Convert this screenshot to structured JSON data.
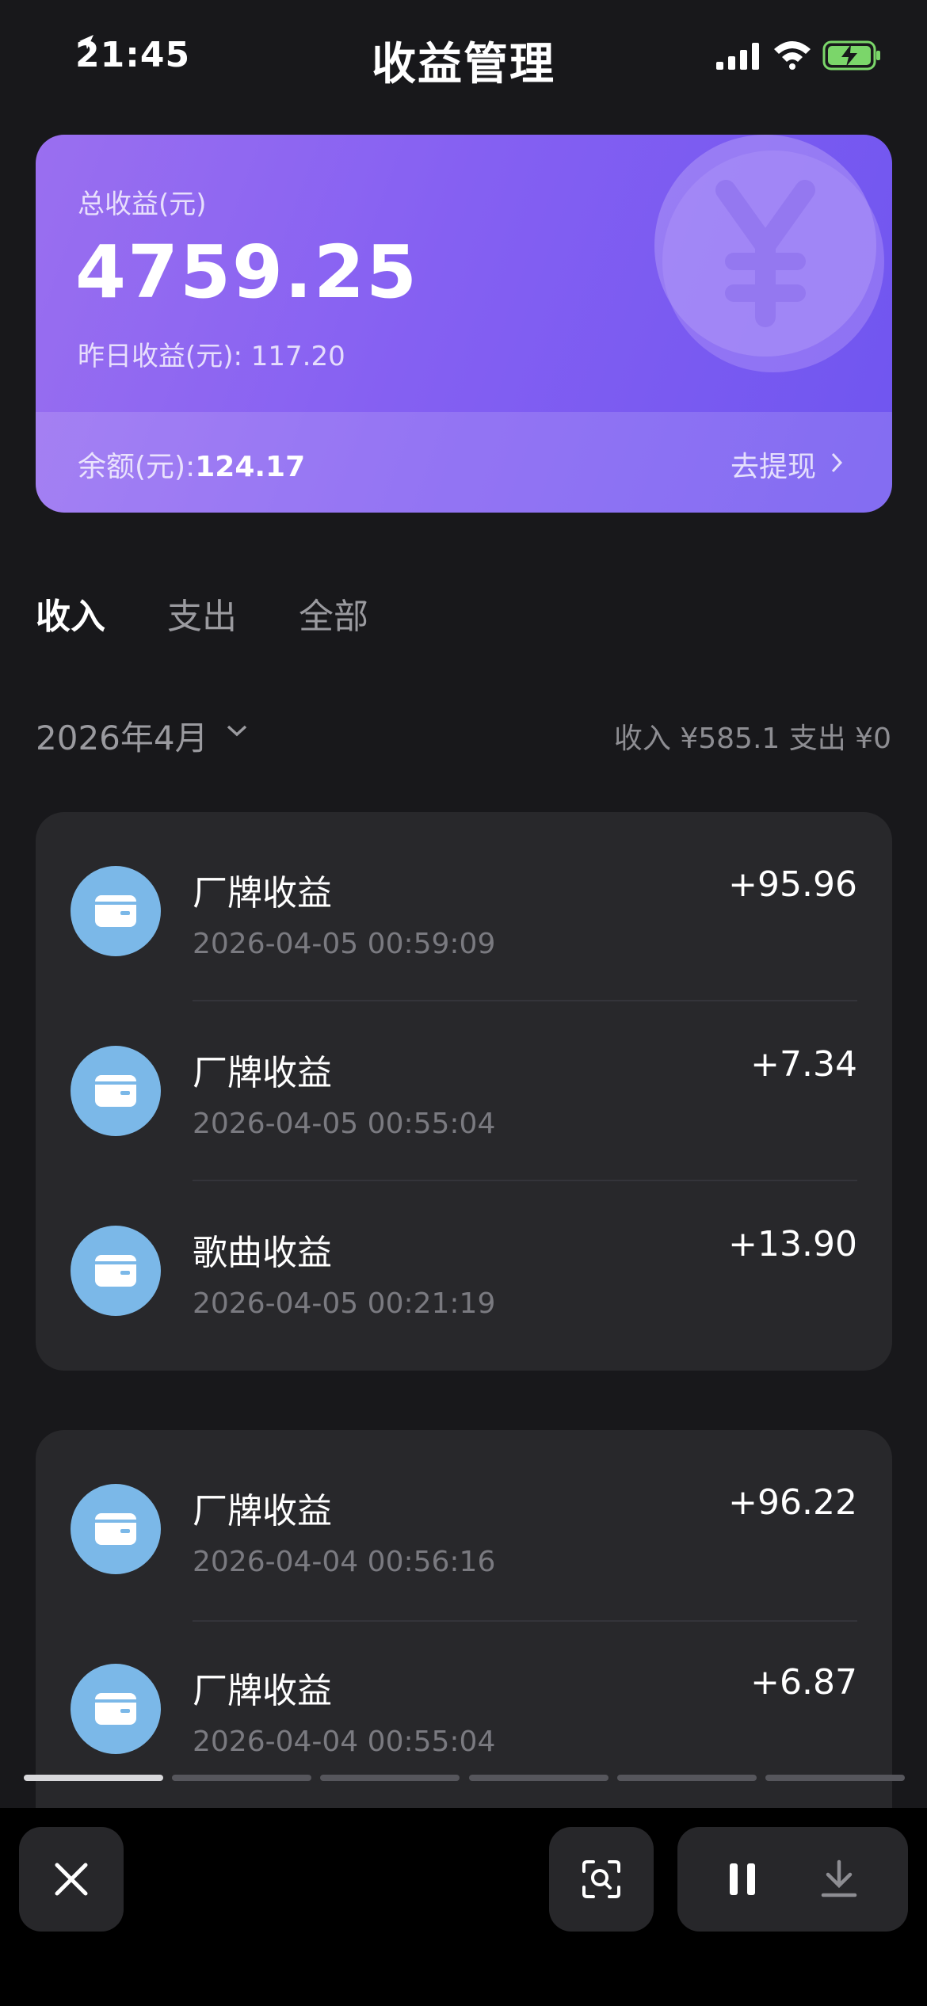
{
  "status_bar": {
    "time": "21:45",
    "title": "收益管理",
    "icons": [
      "location-arrow-icon",
      "signal-icon",
      "wifi-icon",
      "battery-charging-icon"
    ]
  },
  "earnings_card": {
    "total_label": "总收益(元)",
    "total_value": "4759.25",
    "yesterday_label": "昨日收益(元): 117.20",
    "balance_label": "余额(元):",
    "balance_value": "124.17",
    "withdraw_label": "去提现",
    "decoration_icon": "yuan-coin-icon"
  },
  "tabs": [
    {
      "label": "收入",
      "active": true
    },
    {
      "label": "支出",
      "active": false
    },
    {
      "label": "全部",
      "active": false
    }
  ],
  "filter": {
    "month": "2026年4月",
    "summary": "收入 ¥585.1 支出 ¥0"
  },
  "groups": [
    {
      "records": [
        {
          "title": "厂牌收益",
          "time": "2026-04-05 00:59:09",
          "amount": "+95.96"
        },
        {
          "title": "厂牌收益",
          "time": "2026-04-05 00:55:04",
          "amount": "+7.34"
        },
        {
          "title": "歌曲收益",
          "time": "2026-04-05 00:21:19",
          "amount": "+13.90"
        }
      ]
    },
    {
      "records": [
        {
          "title": "厂牌收益",
          "time": "2026-04-04 00:56:16",
          "amount": "+96.22"
        },
        {
          "title": "厂牌收益",
          "time": "2026-04-04 00:55:04",
          "amount": "+6.87"
        }
      ]
    }
  ],
  "progress": {
    "segments": 6,
    "completed": 1
  },
  "toolbar": {
    "close_icon": "close-icon",
    "scan_icon": "screen-scan-icon",
    "pause_icon": "pause-icon",
    "download_icon": "download-icon"
  },
  "colors": {
    "background": "#18181b",
    "card_gradient_start": "#9a6ff0",
    "card_gradient_end": "#6f55f0",
    "record_icon": "#7bb8e8",
    "group_bg": "#28282b"
  }
}
